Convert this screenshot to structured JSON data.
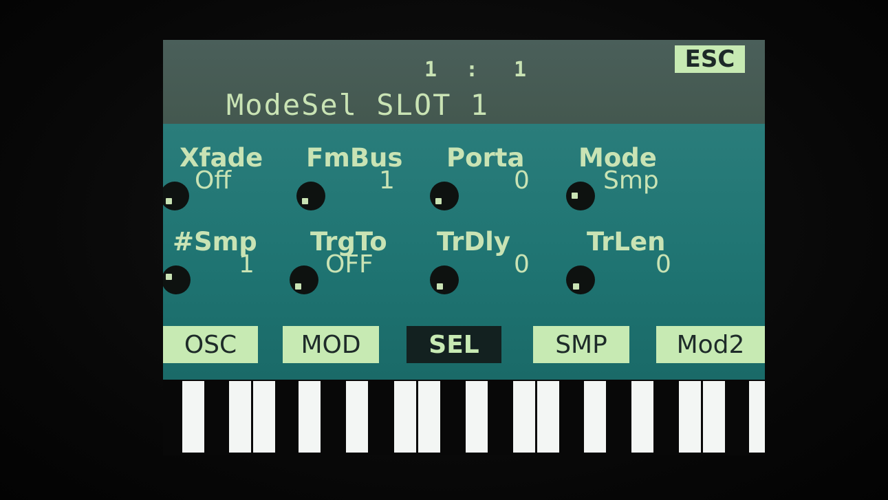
{
  "header": {
    "counter_left": "1",
    "counter_sep": ":",
    "counter_right": "1",
    "esc_label": "ESC",
    "title": "ModeSel SLOT 1"
  },
  "params_row1": [
    {
      "label": "Xfade",
      "value": "Off"
    },
    {
      "label": "FmBus",
      "value": "1"
    },
    {
      "label": "Porta",
      "value": "0"
    },
    {
      "label": "Mode",
      "value": "Smp"
    }
  ],
  "params_row2": [
    {
      "label": "#Smp",
      "value": "1"
    },
    {
      "label": "TrgTo",
      "value": "OFF"
    },
    {
      "label": "TrDly",
      "value": "0"
    },
    {
      "label": "TrLen",
      "value": "0"
    }
  ],
  "tabs": [
    {
      "label": "OSC"
    },
    {
      "label": "MOD"
    },
    {
      "label": "SEL",
      "active": true
    },
    {
      "label": "SMP"
    },
    {
      "label": "Mod2"
    }
  ],
  "colors": {
    "screen_text": "#c9e3b4",
    "panel_teal": "#1f7472",
    "header_bg": "#4a5f5a",
    "tab_bg": "#c7eab3",
    "tab_active_bg": "#132120"
  }
}
